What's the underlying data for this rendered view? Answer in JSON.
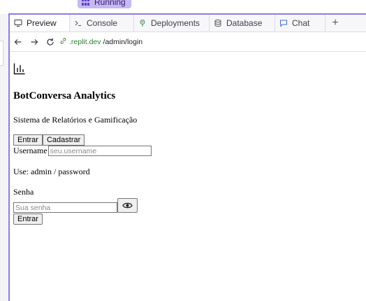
{
  "running_badge": {
    "label": "Running",
    "icon": "grid-icon"
  },
  "tabs": [
    {
      "label": "Preview",
      "icon": "monitor-icon",
      "active": true
    },
    {
      "label": "Console",
      "icon": "terminal-icon",
      "active": false
    },
    {
      "label": "Deployments",
      "icon": "deploy-icon",
      "active": false
    },
    {
      "label": "Database",
      "icon": "database-icon",
      "active": false
    },
    {
      "label": "Chat",
      "icon": "chat-icon",
      "active": false
    }
  ],
  "add_tab": "+",
  "url": {
    "domain": ".replit.dev",
    "path": "/admin/login"
  },
  "page": {
    "logo_icon": "bar-chart-icon",
    "title": "BotConversa Analytics",
    "subtitle": "Sistema de Relatórios e Gamificação",
    "tab_login": "Entrar",
    "tab_register": "Cadastrar",
    "username_label": "Username",
    "username_placeholder": "seu.username",
    "hint": "Use: admin / password",
    "password_label": "Senha",
    "password_placeholder": "Sua senha",
    "eye_icon": "eye-icon",
    "submit_label": "Entrar"
  },
  "colors": {
    "accent": "#8d7ce6",
    "badge_bg": "#c7b8f5",
    "domain_green": "#2e7d32"
  }
}
